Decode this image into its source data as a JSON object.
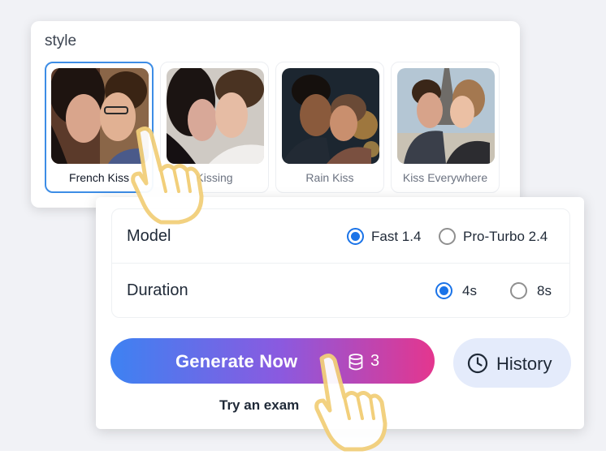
{
  "style_section": {
    "title": "style",
    "tiles": [
      {
        "label": "French Kiss",
        "selected": true
      },
      {
        "label": "Kissing",
        "selected": false
      },
      {
        "label": "Rain Kiss",
        "selected": false
      },
      {
        "label": "Kiss Everywhere",
        "selected": false
      }
    ]
  },
  "settings": {
    "model": {
      "label": "Model",
      "options": [
        "Fast 1.4",
        "Pro-Turbo 2.4"
      ],
      "selected": "Fast 1.4"
    },
    "duration": {
      "label": "Duration",
      "options": [
        "4s",
        "8s"
      ],
      "selected": "4s"
    }
  },
  "actions": {
    "generate_label": "Generate Now",
    "credit_icon": "database-icon",
    "credit_cost": "3",
    "history_label": "History",
    "history_icon": "clock-icon",
    "try_example": "Try an exam"
  },
  "colors": {
    "accent": "#1a73e8",
    "selected_border": "#3d8de6",
    "gradient_start": "#3d82f2",
    "gradient_end": "#e4368e",
    "history_bg": "#e4ebfb"
  }
}
